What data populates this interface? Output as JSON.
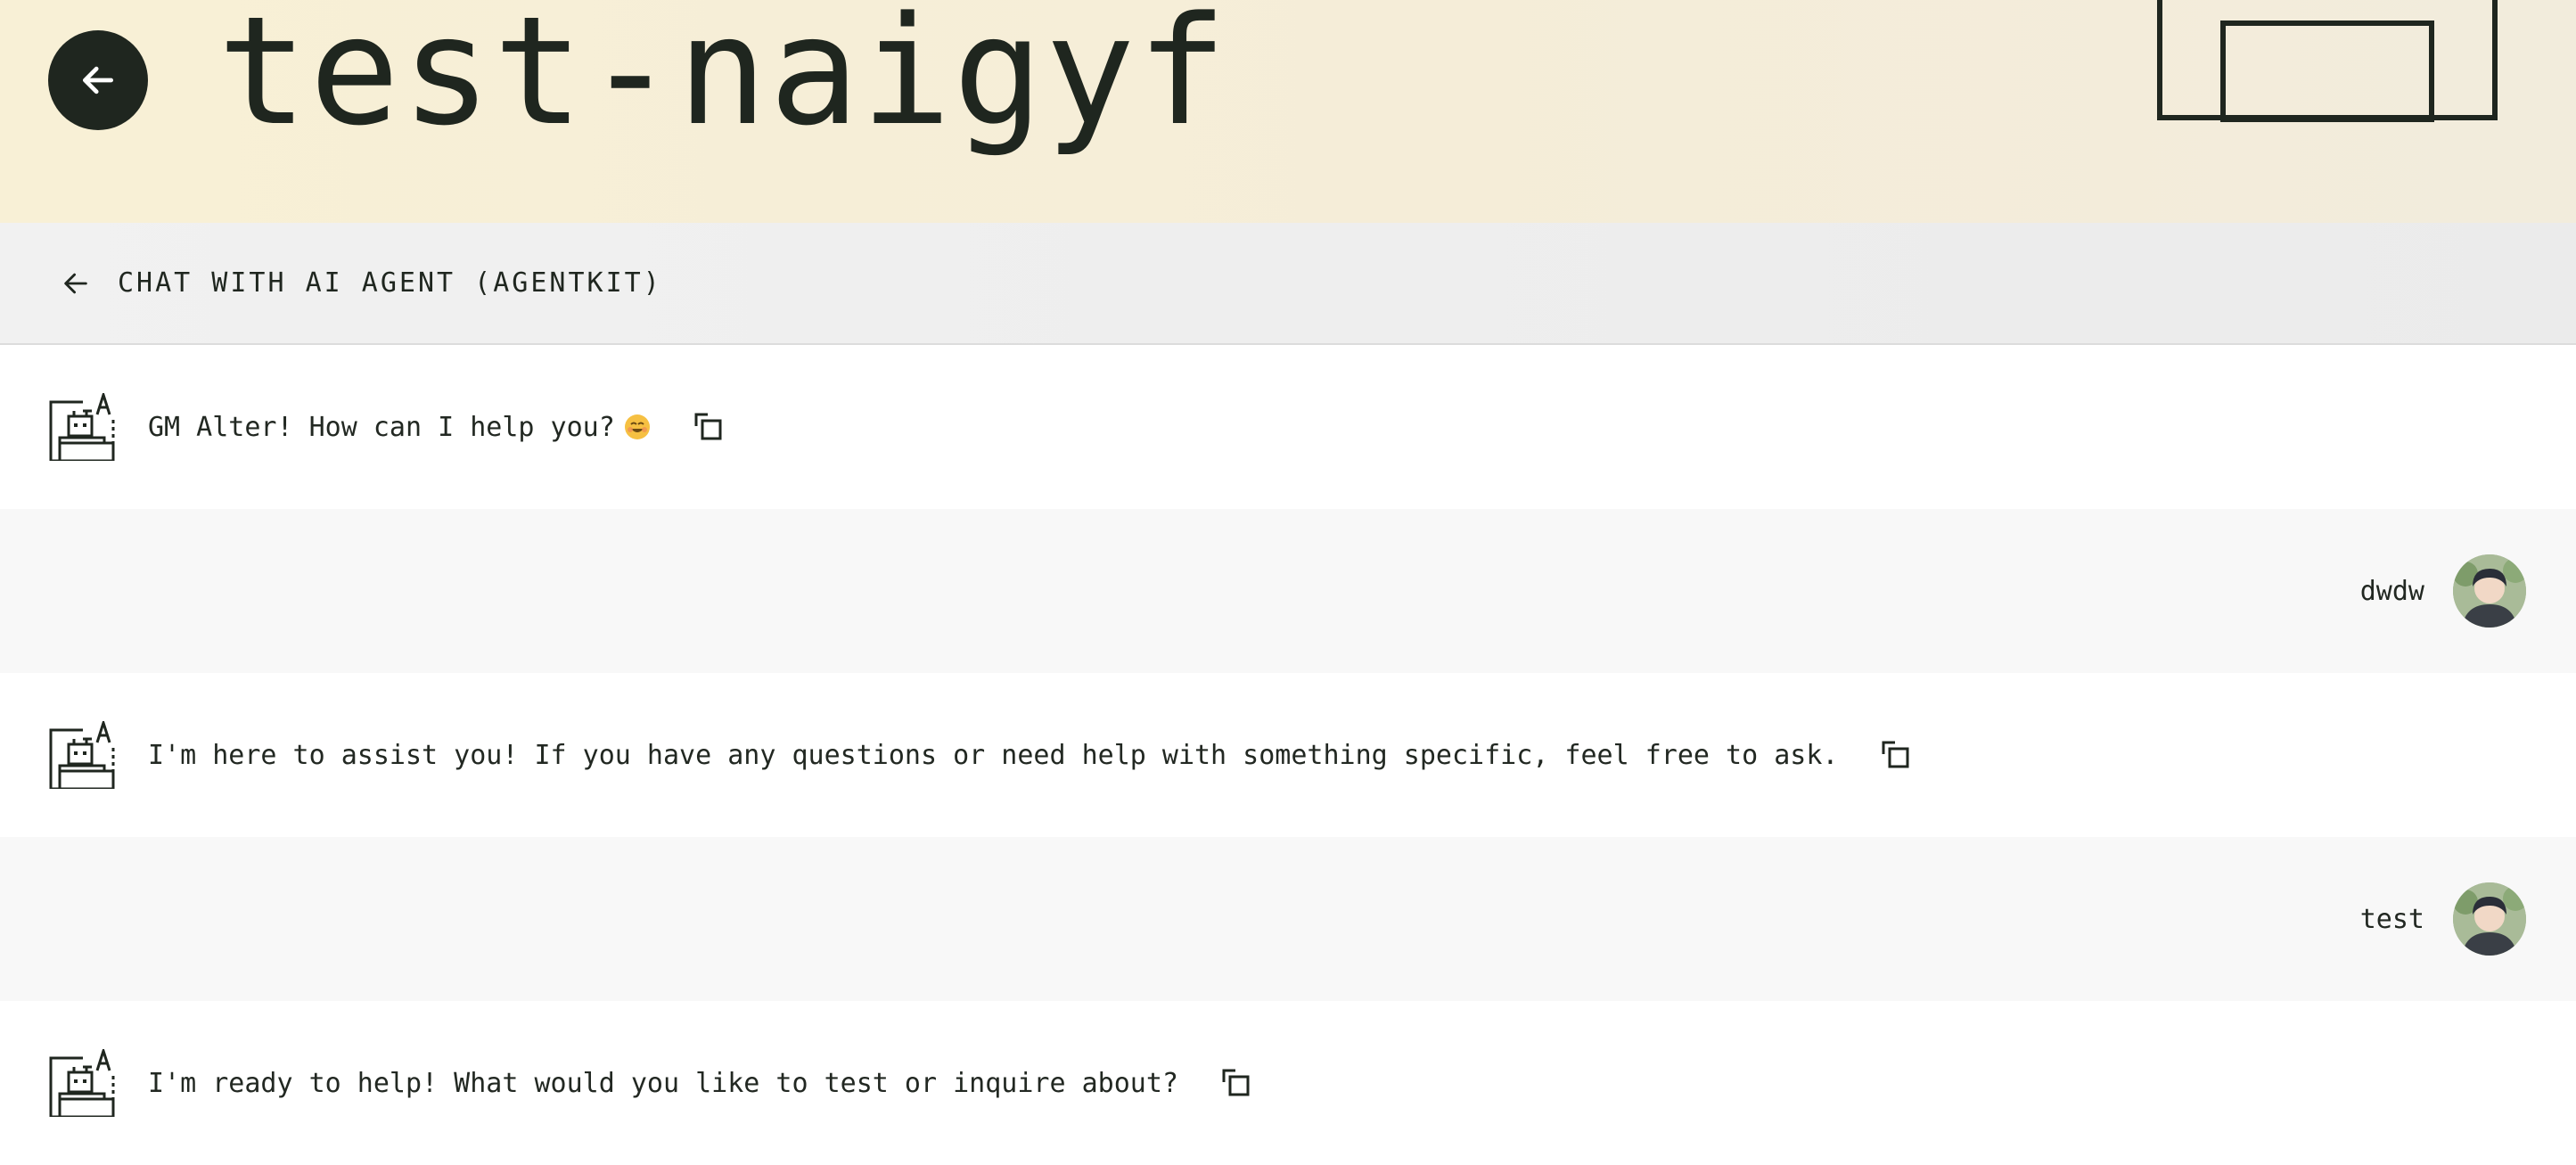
{
  "header": {
    "title": "test-naigyf"
  },
  "subheader": {
    "label": "CHAT WITH AI AGENT (AGENTKIT)"
  },
  "messages": [
    {
      "role": "agent",
      "text": "GM Alter! How can I help you?",
      "emoji": "smiling-face-icon"
    },
    {
      "role": "user",
      "text": "dwdw"
    },
    {
      "role": "agent",
      "text": "I'm here to assist you! If you have any questions or need help with something specific, feel free to ask."
    },
    {
      "role": "user",
      "text": "test"
    },
    {
      "role": "agent",
      "text": "I'm ready to help! What would you like to test or inquire about?"
    }
  ],
  "colors": {
    "header_bg": "#f8f0d6",
    "dark": "#1f261f",
    "subbar_bg": "#efefef",
    "user_row_bg": "#f8f8f8"
  }
}
